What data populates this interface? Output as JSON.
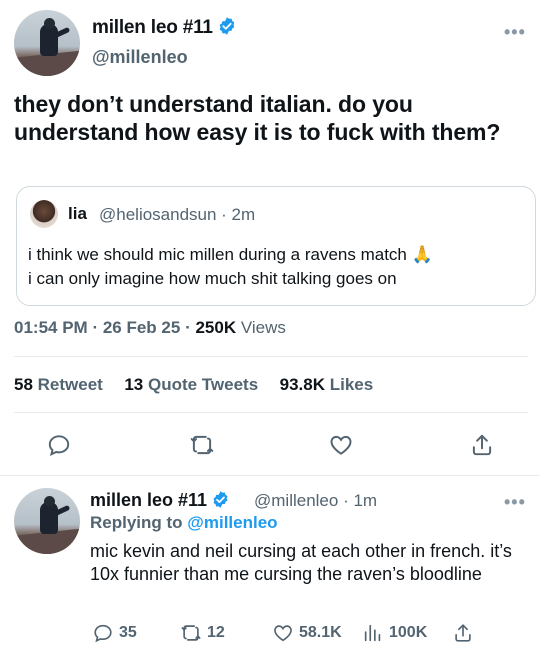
{
  "tweet": {
    "author_name": "millen leo #11",
    "author_handle": "@millenleo",
    "more": "•••",
    "text": "they don’t understand italian. do you understand how easy it is to fuck with them?",
    "quote": {
      "name": "lia",
      "handle_time": "@heliosandsun · 2m",
      "text_line1": "i think we should mic millen during a ravens match 🙏",
      "text_line2": "i can only imagine how much shit talking goes on"
    },
    "time": "01:54 PM",
    "date": "26 Feb 25",
    "views_count": "250K",
    "views_label": "Views",
    "retweets_count": "58",
    "retweets_label": "Retweet",
    "quotes_count": "13",
    "quotes_label": "Quote Tweets",
    "likes_count": "93.8K",
    "likes_label": "Likes"
  },
  "reply": {
    "author_name": "millen leo #11",
    "handle_time": "@millenleo · 1m",
    "more": "•••",
    "replying_prefix": "Replying to",
    "replying_mention": "@millenleo",
    "text": "mic kevin and neil cursing at each other in french. it’s 10x funnier than me cursing the raven’s bloodline",
    "replies": "35",
    "retweets": "12",
    "likes": "58.1K",
    "views": "100K"
  },
  "colors": {
    "accent": "#1d9bf0",
    "secondary_text": "#536471",
    "divider": "#e6ebee"
  },
  "icons": [
    "verified-icon",
    "more-icon",
    "reply-icon",
    "retweet-icon",
    "like-icon",
    "share-icon",
    "views-icon"
  ]
}
